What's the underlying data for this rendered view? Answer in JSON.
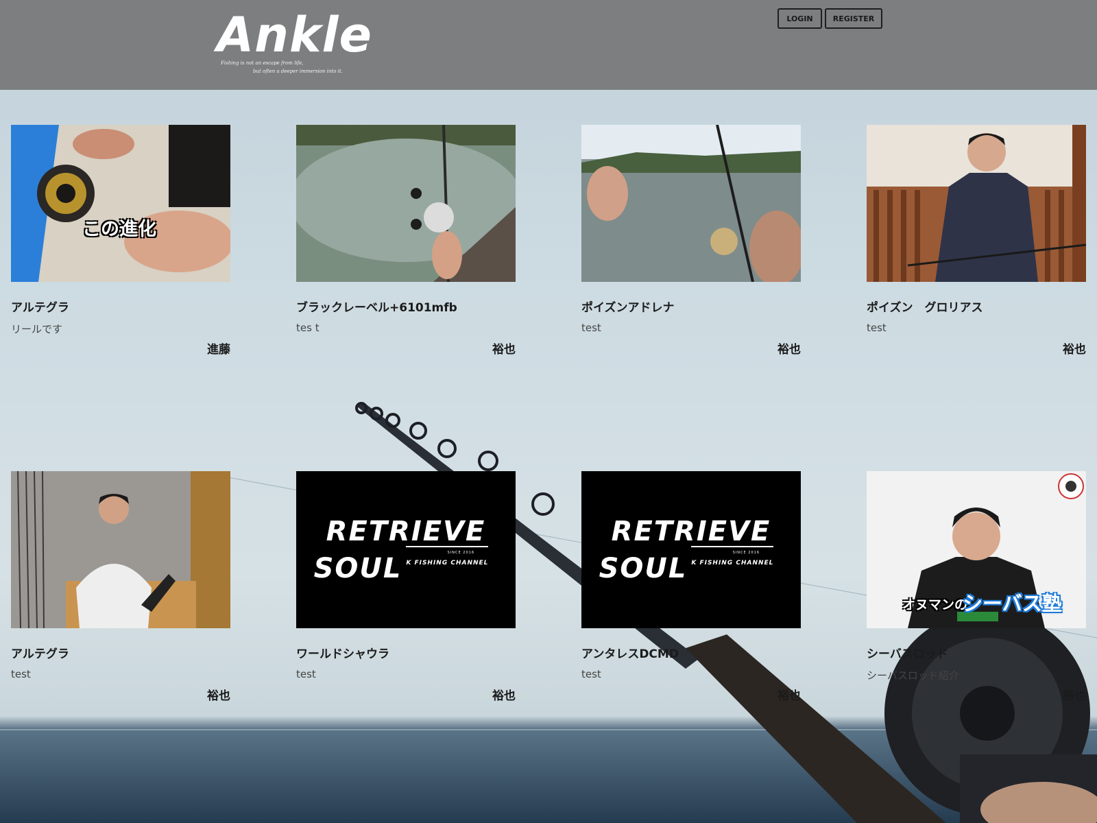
{
  "header": {
    "logo": "Ankle",
    "tagline_line1": "Fishing is not an escape from life,",
    "tagline_line2": "but often a deeper immersion into it.",
    "login_label": "LOGIN",
    "register_label": "REGISTER"
  },
  "posts": [
    {
      "title": "アルテグラ",
      "description": "リールです",
      "user": "進藤",
      "thumb_caption": "この進化"
    },
    {
      "title": "ブラックレーベル+6101mfb",
      "description": "tes t",
      "user": "裕也"
    },
    {
      "title": "ポイズンアドレナ",
      "description": "test",
      "user": "裕也"
    },
    {
      "title": "ポイズン　グロリアス",
      "description": "test",
      "user": "裕也"
    },
    {
      "title": "アルテグラ",
      "description": "test",
      "user": "裕也"
    },
    {
      "title": "ワールドシャウラ",
      "description": "test",
      "user": "裕也",
      "thumb_brand_line1": "RETRIEVE",
      "thumb_brand_line2": "SOUL",
      "thumb_brand_sub": "K FISHING CHANNEL",
      "thumb_brand_since": "SINCE 2016"
    },
    {
      "title": "アンタレスDCMD",
      "description": "test",
      "user": "裕也",
      "thumb_brand_line1": "RETRIEVE",
      "thumb_brand_line2": "SOUL",
      "thumb_brand_sub": "K FISHING CHANNEL",
      "thumb_brand_since": "SINCE 2016"
    },
    {
      "title": "シーバスロッド",
      "description": "シーバスロッド紹介",
      "user": "裕也",
      "thumb_caption_a": "オヌマンの",
      "thumb_caption_b": "シーバス塾"
    }
  ]
}
